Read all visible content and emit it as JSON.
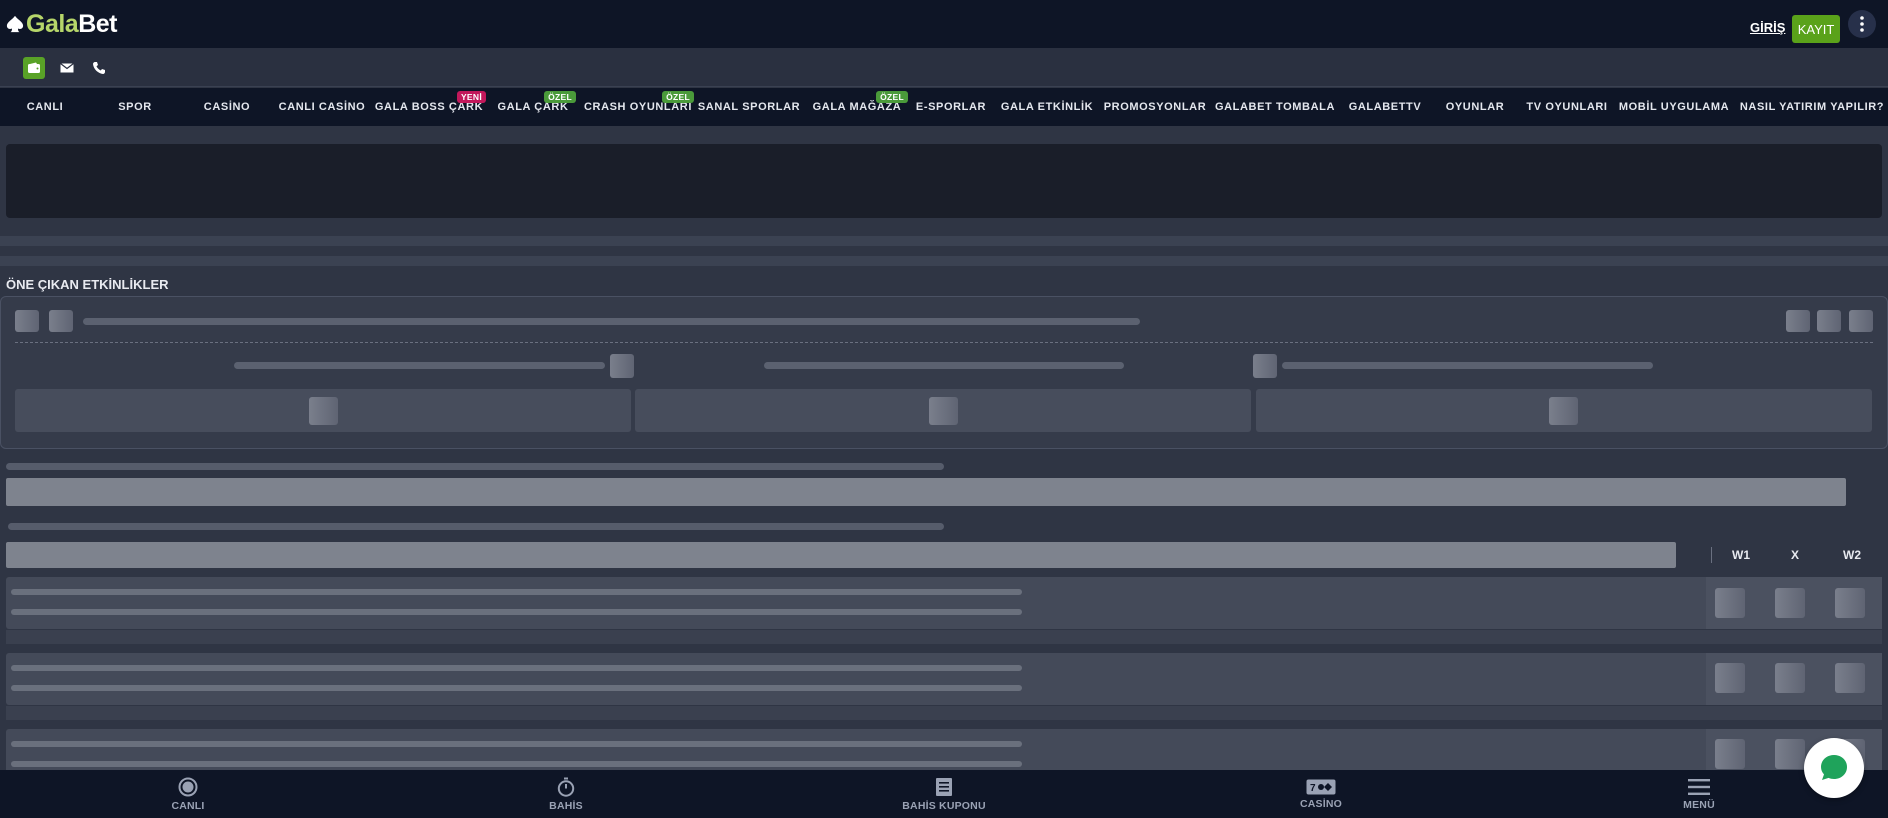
{
  "header": {
    "logo_part1": "Gala",
    "logo_part2": "Bet",
    "login_label": "GİRİŞ",
    "register_label": "KAYIT",
    "icons": [
      "spade-icon",
      "kebab-menu-icon"
    ]
  },
  "subbar": {
    "icons": [
      "wallet-icon",
      "mail-icon",
      "phone-icon"
    ],
    "accent": "#59a227"
  },
  "nav": {
    "items": [
      {
        "label": "CANLI"
      },
      {
        "label": "SPOR"
      },
      {
        "label": "CASİNO"
      },
      {
        "label": "CANLI CASİNO"
      },
      {
        "label": "GALA BOSS ÇARK",
        "badge": "YENİ",
        "badge_color": "#c2185b"
      },
      {
        "label": "GALA ÇARK",
        "badge": "ÖZEL",
        "badge_color": "#4a9a3a"
      },
      {
        "label": "CRASH OYUNLARI",
        "badge": "ÖZEL",
        "badge_color": "#4a9a3a"
      },
      {
        "label": "SANAL SPORLAR"
      },
      {
        "label": "GALA MAĞAZA",
        "badge": "ÖZEL",
        "badge_color": "#4a9a3a"
      },
      {
        "label": "E-SPORLAR"
      },
      {
        "label": "GALA ETKİNLİK"
      },
      {
        "label": "PROMOSYONLAR"
      },
      {
        "label": "GALABET TOMBALA"
      },
      {
        "label": "GALABETTV"
      },
      {
        "label": "OYUNLAR"
      },
      {
        "label": "TV OYUNLARI"
      },
      {
        "label": "MOBİL UYGULAMA"
      },
      {
        "label": "NASIL YATIRIM YAPILIR?"
      }
    ]
  },
  "featured": {
    "title": "ÖNE ÇIKAN ETKİNLİKLER"
  },
  "odds_table": {
    "columns": [
      "W1",
      "X",
      "W2"
    ]
  },
  "tabbar": {
    "items": [
      {
        "label": "CANLI",
        "icon": "live-icon"
      },
      {
        "label": "BAHİS",
        "icon": "stopwatch-icon"
      },
      {
        "label": "BAHİS KUPONU",
        "icon": "betslip-icon"
      },
      {
        "label": "CASİNO",
        "icon": "slot-icon"
      },
      {
        "label": "MENÜ",
        "icon": "hamburger-icon"
      }
    ]
  },
  "chat": {
    "icon": "chat-icon",
    "color": "#1fa35b"
  },
  "colors": {
    "brand_green": "#5aa21a",
    "header_bg": "#0e1526",
    "page_bg": "#2f3544"
  }
}
